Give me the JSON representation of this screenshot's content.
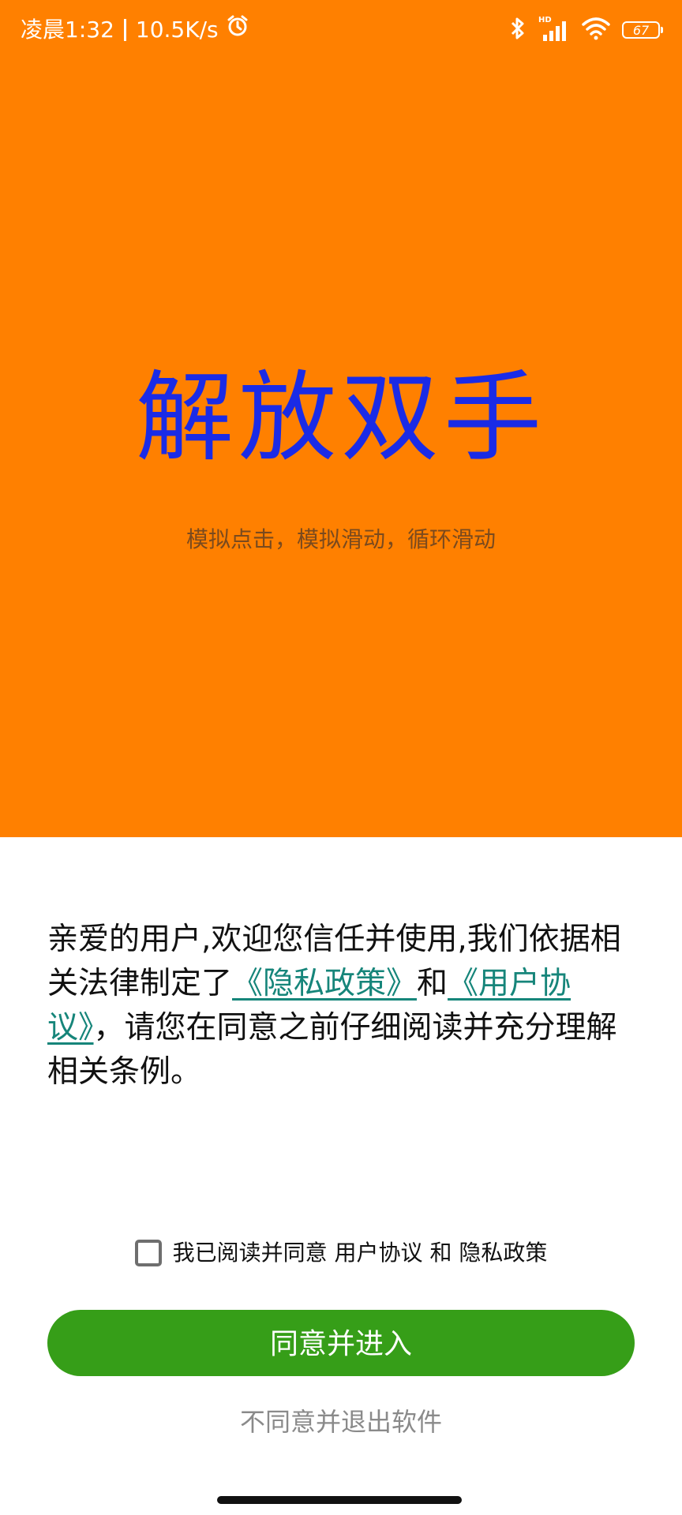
{
  "status_bar": {
    "time": "凌晨1:32",
    "network_speed": "10.5K/s",
    "hd_label": "HD",
    "battery": "67",
    "icons": [
      "alarm-icon",
      "bluetooth-icon",
      "signal-icon",
      "wifi-icon",
      "battery-icon"
    ]
  },
  "hero": {
    "title": "解放双手",
    "subtitle": "模拟点击，模拟滑动，循环滑动",
    "background_color": "#FF8000",
    "title_color": "#1A2BE6"
  },
  "agreement": {
    "text_1": "亲爱的用户,欢迎您信任并使用,我们依据相关法律制定了",
    "privacy_link": "《隐私政策》",
    "text_2": "和",
    "user_agreement_link": "《用户协议》",
    "text_3": "，请您在同意之前仔细阅读并充分理解相关条例。",
    "link_color": "#16857A"
  },
  "consent": {
    "label": "我已阅读并同意 用户协议 和 隐私政策",
    "checked": false
  },
  "actions": {
    "agree_label": "同意并进入",
    "decline_label": "不同意并退出软件",
    "agree_color": "#369E18"
  }
}
